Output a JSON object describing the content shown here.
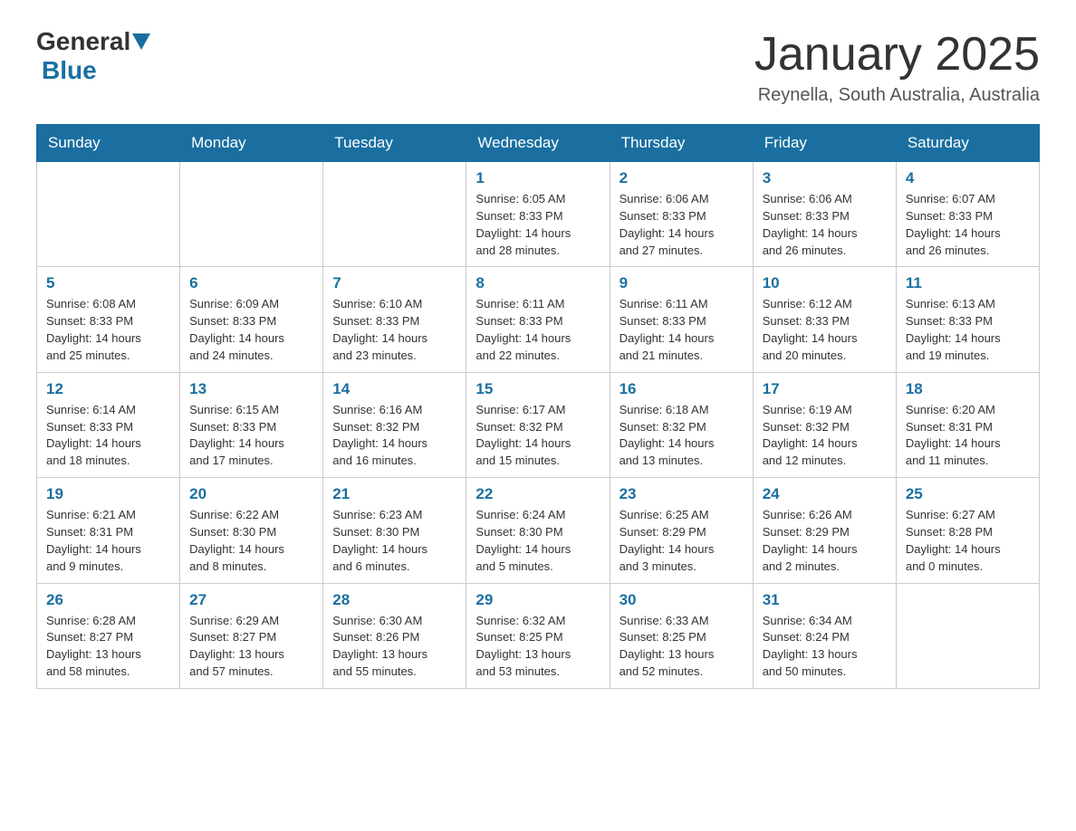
{
  "header": {
    "logo_general": "General",
    "logo_blue": "Blue",
    "title": "January 2025",
    "subtitle": "Reynella, South Australia, Australia"
  },
  "days_of_week": [
    "Sunday",
    "Monday",
    "Tuesday",
    "Wednesday",
    "Thursday",
    "Friday",
    "Saturday"
  ],
  "weeks": [
    [
      {
        "day": "",
        "info": ""
      },
      {
        "day": "",
        "info": ""
      },
      {
        "day": "",
        "info": ""
      },
      {
        "day": "1",
        "info": "Sunrise: 6:05 AM\nSunset: 8:33 PM\nDaylight: 14 hours\nand 28 minutes."
      },
      {
        "day": "2",
        "info": "Sunrise: 6:06 AM\nSunset: 8:33 PM\nDaylight: 14 hours\nand 27 minutes."
      },
      {
        "day": "3",
        "info": "Sunrise: 6:06 AM\nSunset: 8:33 PM\nDaylight: 14 hours\nand 26 minutes."
      },
      {
        "day": "4",
        "info": "Sunrise: 6:07 AM\nSunset: 8:33 PM\nDaylight: 14 hours\nand 26 minutes."
      }
    ],
    [
      {
        "day": "5",
        "info": "Sunrise: 6:08 AM\nSunset: 8:33 PM\nDaylight: 14 hours\nand 25 minutes."
      },
      {
        "day": "6",
        "info": "Sunrise: 6:09 AM\nSunset: 8:33 PM\nDaylight: 14 hours\nand 24 minutes."
      },
      {
        "day": "7",
        "info": "Sunrise: 6:10 AM\nSunset: 8:33 PM\nDaylight: 14 hours\nand 23 minutes."
      },
      {
        "day": "8",
        "info": "Sunrise: 6:11 AM\nSunset: 8:33 PM\nDaylight: 14 hours\nand 22 minutes."
      },
      {
        "day": "9",
        "info": "Sunrise: 6:11 AM\nSunset: 8:33 PM\nDaylight: 14 hours\nand 21 minutes."
      },
      {
        "day": "10",
        "info": "Sunrise: 6:12 AM\nSunset: 8:33 PM\nDaylight: 14 hours\nand 20 minutes."
      },
      {
        "day": "11",
        "info": "Sunrise: 6:13 AM\nSunset: 8:33 PM\nDaylight: 14 hours\nand 19 minutes."
      }
    ],
    [
      {
        "day": "12",
        "info": "Sunrise: 6:14 AM\nSunset: 8:33 PM\nDaylight: 14 hours\nand 18 minutes."
      },
      {
        "day": "13",
        "info": "Sunrise: 6:15 AM\nSunset: 8:33 PM\nDaylight: 14 hours\nand 17 minutes."
      },
      {
        "day": "14",
        "info": "Sunrise: 6:16 AM\nSunset: 8:32 PM\nDaylight: 14 hours\nand 16 minutes."
      },
      {
        "day": "15",
        "info": "Sunrise: 6:17 AM\nSunset: 8:32 PM\nDaylight: 14 hours\nand 15 minutes."
      },
      {
        "day": "16",
        "info": "Sunrise: 6:18 AM\nSunset: 8:32 PM\nDaylight: 14 hours\nand 13 minutes."
      },
      {
        "day": "17",
        "info": "Sunrise: 6:19 AM\nSunset: 8:32 PM\nDaylight: 14 hours\nand 12 minutes."
      },
      {
        "day": "18",
        "info": "Sunrise: 6:20 AM\nSunset: 8:31 PM\nDaylight: 14 hours\nand 11 minutes."
      }
    ],
    [
      {
        "day": "19",
        "info": "Sunrise: 6:21 AM\nSunset: 8:31 PM\nDaylight: 14 hours\nand 9 minutes."
      },
      {
        "day": "20",
        "info": "Sunrise: 6:22 AM\nSunset: 8:30 PM\nDaylight: 14 hours\nand 8 minutes."
      },
      {
        "day": "21",
        "info": "Sunrise: 6:23 AM\nSunset: 8:30 PM\nDaylight: 14 hours\nand 6 minutes."
      },
      {
        "day": "22",
        "info": "Sunrise: 6:24 AM\nSunset: 8:30 PM\nDaylight: 14 hours\nand 5 minutes."
      },
      {
        "day": "23",
        "info": "Sunrise: 6:25 AM\nSunset: 8:29 PM\nDaylight: 14 hours\nand 3 minutes."
      },
      {
        "day": "24",
        "info": "Sunrise: 6:26 AM\nSunset: 8:29 PM\nDaylight: 14 hours\nand 2 minutes."
      },
      {
        "day": "25",
        "info": "Sunrise: 6:27 AM\nSunset: 8:28 PM\nDaylight: 14 hours\nand 0 minutes."
      }
    ],
    [
      {
        "day": "26",
        "info": "Sunrise: 6:28 AM\nSunset: 8:27 PM\nDaylight: 13 hours\nand 58 minutes."
      },
      {
        "day": "27",
        "info": "Sunrise: 6:29 AM\nSunset: 8:27 PM\nDaylight: 13 hours\nand 57 minutes."
      },
      {
        "day": "28",
        "info": "Sunrise: 6:30 AM\nSunset: 8:26 PM\nDaylight: 13 hours\nand 55 minutes."
      },
      {
        "day": "29",
        "info": "Sunrise: 6:32 AM\nSunset: 8:25 PM\nDaylight: 13 hours\nand 53 minutes."
      },
      {
        "day": "30",
        "info": "Sunrise: 6:33 AM\nSunset: 8:25 PM\nDaylight: 13 hours\nand 52 minutes."
      },
      {
        "day": "31",
        "info": "Sunrise: 6:34 AM\nSunset: 8:24 PM\nDaylight: 13 hours\nand 50 minutes."
      },
      {
        "day": "",
        "info": ""
      }
    ]
  ]
}
